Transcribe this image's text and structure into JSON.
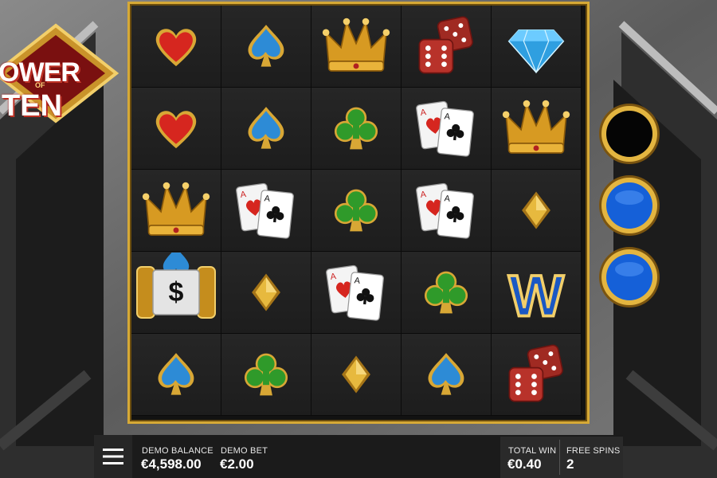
{
  "logo": {
    "line1": "OWER",
    "of": "OF",
    "line2": "TEN"
  },
  "reels": {
    "columns": [
      [
        "heart",
        "heart",
        "crown",
        "coin-spade",
        "spade"
      ],
      [
        "spade",
        "spade",
        "aces",
        "diamond",
        "club"
      ],
      [
        "crown",
        "club",
        "club",
        "aces",
        "diamond"
      ],
      [
        "dice",
        "aces",
        "aces",
        "club",
        "spade"
      ],
      [
        "gem",
        "crown",
        "diamond",
        "wild",
        "dice"
      ]
    ],
    "wild_letter": "W",
    "cash_symbol": "$"
  },
  "side_orbs": [
    {
      "state": "empty"
    },
    {
      "state": "filled"
    },
    {
      "state": "filled"
    }
  ],
  "bottom_bar": {
    "balance_label": "DEMO BALANCE",
    "balance_value": "€4,598.00",
    "bet_label": "DEMO BET",
    "bet_value": "€2.00",
    "total_win_label": "TOTAL WIN",
    "total_win_value": "€0.40",
    "free_spins_label": "FREE SPINS",
    "free_spins_value": "2"
  },
  "colors": {
    "frame_gold": "#d6a936",
    "orb_blue": "#1560d8",
    "heart_red": "#d6261f",
    "club_green": "#2f9a2a",
    "spade_blue": "#2d8bd6"
  }
}
